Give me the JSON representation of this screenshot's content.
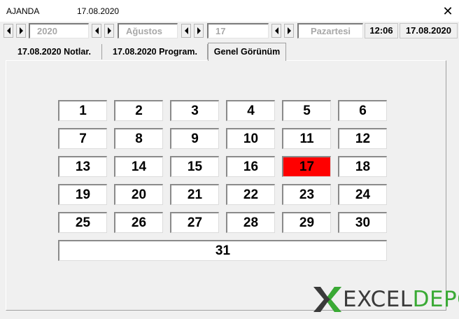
{
  "window": {
    "app_name": "AJANDA",
    "date": "17.08.2020",
    "close_glyph": "✕"
  },
  "toolbar": {
    "year": "2020",
    "month": "Ağustos",
    "day": "17",
    "weekday": "Pazartesi",
    "time": "12:06",
    "date": "17.08.2020",
    "spin_prev_icon": "triangle-left",
    "spin_next_icon": "triangle-right"
  },
  "tabs": [
    {
      "label": "17.08.2020  Notlar."
    },
    {
      "label": "17.08.2020  Program."
    },
    {
      "label": "Genel Görünüm",
      "active": true
    }
  ],
  "calendar": {
    "days": [
      "1",
      "2",
      "3",
      "4",
      "5",
      "6",
      "7",
      "8",
      "9",
      "10",
      "11",
      "12",
      "13",
      "14",
      "15",
      "16",
      "17",
      "18",
      "19",
      "20",
      "21",
      "22",
      "23",
      "24",
      "25",
      "26",
      "27",
      "28",
      "29",
      "30",
      "31"
    ],
    "selected_day": "17",
    "selected_color": "#ff0000"
  },
  "logo": {
    "part1": "EXCEL",
    "part2": "DEPO",
    "color_dark": "#3a3a3a",
    "color_green": "#3aaa35"
  }
}
